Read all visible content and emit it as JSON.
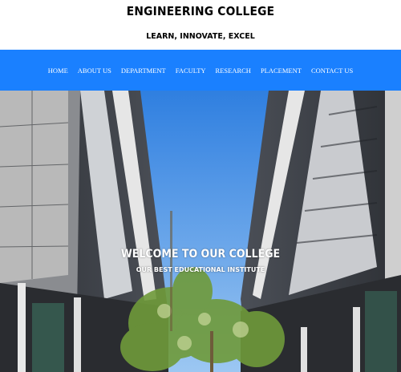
{
  "header": {
    "title": "ENGINEERING COLLEGE",
    "tagline": "LEARN, INNOVATE, EXCEL"
  },
  "nav": {
    "items": [
      {
        "label": "HOME"
      },
      {
        "label": "ABOUT US"
      },
      {
        "label": "DEPARTMENT"
      },
      {
        "label": "FACULTY"
      },
      {
        "label": "RESEARCH"
      },
      {
        "label": "PLACEMENT"
      },
      {
        "label": "CONTACT US"
      }
    ]
  },
  "hero": {
    "title": "WELCOME TO OUR COLLEGE",
    "subtitle": "OUR BEST EDUCATIONAL INSTITUTE"
  },
  "colors": {
    "nav_background": "#1a80ff",
    "sky": "#3f8ee6",
    "building_dark": "#3c3f45",
    "building_light": "#d9d9d9"
  }
}
